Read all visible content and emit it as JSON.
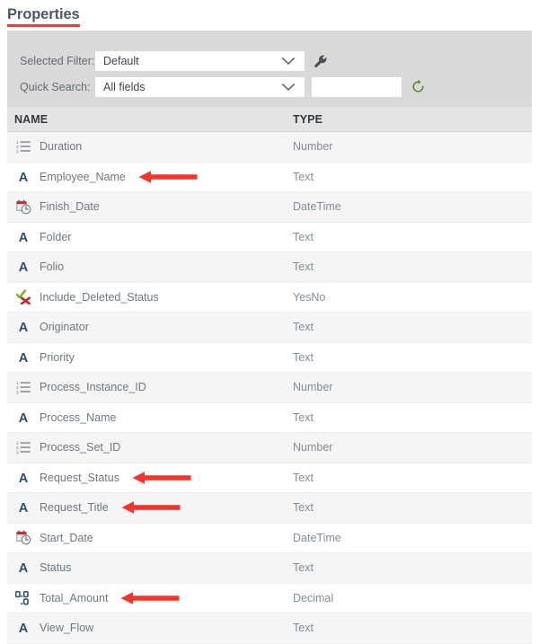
{
  "page": {
    "title": "Properties",
    "title_underline_color": "#fd3a34"
  },
  "filter_panel": {
    "selected_filter": {
      "label": "Selected Filter:",
      "value": "Default",
      "icon": "chevron-down-icon"
    },
    "configure_icon": "wrench-icon",
    "quick_search": {
      "label": "Quick Search:",
      "value": "All fields",
      "icon": "chevron-down-icon"
    },
    "search_input": {
      "value": "",
      "placeholder": ""
    },
    "refresh_icon": "refresh-icon",
    "refresh_color": "#5c8024",
    "panel_color": "#d9d9d9"
  },
  "table": {
    "columns": [
      {
        "key": "name",
        "label": "NAME"
      },
      {
        "key": "type",
        "label": "TYPE"
      }
    ],
    "rows": [
      {
        "name": "Duration",
        "type": "Number",
        "icon": "number-icon",
        "annotated": false
      },
      {
        "name": "Employee_Name",
        "type": "Text",
        "icon": "text-icon",
        "annotated": true
      },
      {
        "name": "Finish_Date",
        "type": "DateTime",
        "icon": "datetime-icon",
        "annotated": false
      },
      {
        "name": "Folder",
        "type": "Text",
        "icon": "text-icon",
        "annotated": false
      },
      {
        "name": "Folio",
        "type": "Text",
        "icon": "text-icon",
        "annotated": false
      },
      {
        "name": "Include_Deleted_Status",
        "type": "YesNo",
        "icon": "yesno-icon",
        "annotated": false
      },
      {
        "name": "Originator",
        "type": "Text",
        "icon": "text-icon",
        "annotated": false
      },
      {
        "name": "Priority",
        "type": "Text",
        "icon": "text-icon",
        "annotated": false
      },
      {
        "name": "Process_Instance_ID",
        "type": "Number",
        "icon": "number-icon",
        "annotated": false
      },
      {
        "name": "Process_Name",
        "type": "Text",
        "icon": "text-icon",
        "annotated": false
      },
      {
        "name": "Process_Set_ID",
        "type": "Number",
        "icon": "number-icon",
        "annotated": false
      },
      {
        "name": "Request_Status",
        "type": "Text",
        "icon": "text-icon",
        "annotated": true
      },
      {
        "name": "Request_Title",
        "type": "Text",
        "icon": "text-icon",
        "annotated": true
      },
      {
        "name": "Start_Date",
        "type": "DateTime",
        "icon": "datetime-icon",
        "annotated": false
      },
      {
        "name": "Status",
        "type": "Text",
        "icon": "text-icon",
        "annotated": false
      },
      {
        "name": "Total_Amount",
        "type": "Decimal",
        "icon": "decimal-icon",
        "annotated": true
      },
      {
        "name": "View_Flow",
        "type": "Text",
        "icon": "text-icon",
        "annotated": false
      }
    ]
  },
  "annotation": {
    "arrow_color": "#f7332b",
    "arrow_direction": "left"
  }
}
